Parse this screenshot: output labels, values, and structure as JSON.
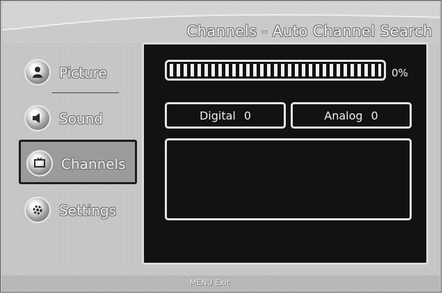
{
  "header": {
    "title": "Channels - Auto Channel Search"
  },
  "sidebar": {
    "items": [
      {
        "label": "Picture",
        "icon": "person-icon"
      },
      {
        "label": "Sound",
        "icon": "speaker-icon"
      },
      {
        "label": "Channels",
        "icon": "tv-icon",
        "selected": true
      },
      {
        "label": "Settings",
        "icon": "gear-icon"
      }
    ]
  },
  "search": {
    "progress_percent": 0,
    "progress_label": "0%",
    "digital_label": "Digital",
    "digital_count": "0",
    "analog_label": "Analog",
    "analog_count": "0"
  },
  "footer": {
    "hint": "MENU  Exit"
  },
  "colors": {
    "panel": "#121212",
    "frame": "#dcdcdc",
    "selected_border": "#1c1c1c"
  }
}
